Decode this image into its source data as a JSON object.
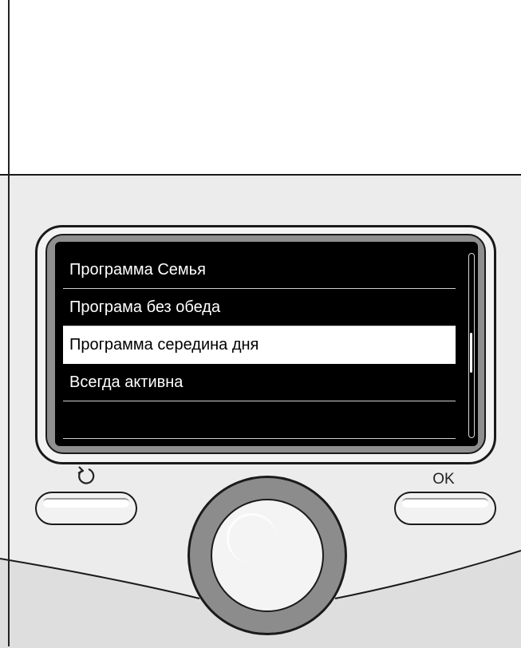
{
  "menu": {
    "items": [
      {
        "label": "Программа Семья"
      },
      {
        "label": "Програмa без обеда"
      },
      {
        "label": "Программа середина дня"
      },
      {
        "label": "Всегда активна"
      }
    ],
    "selected_index": 2,
    "scroll_position": 0.55
  },
  "buttons": {
    "back_icon": "back-arrow-icon",
    "ok_label": "OK"
  },
  "colors": {
    "screen_background": "#000000",
    "selected_background": "#ffffff",
    "menu_text": "#ffffff",
    "device_body": "#ececec"
  }
}
